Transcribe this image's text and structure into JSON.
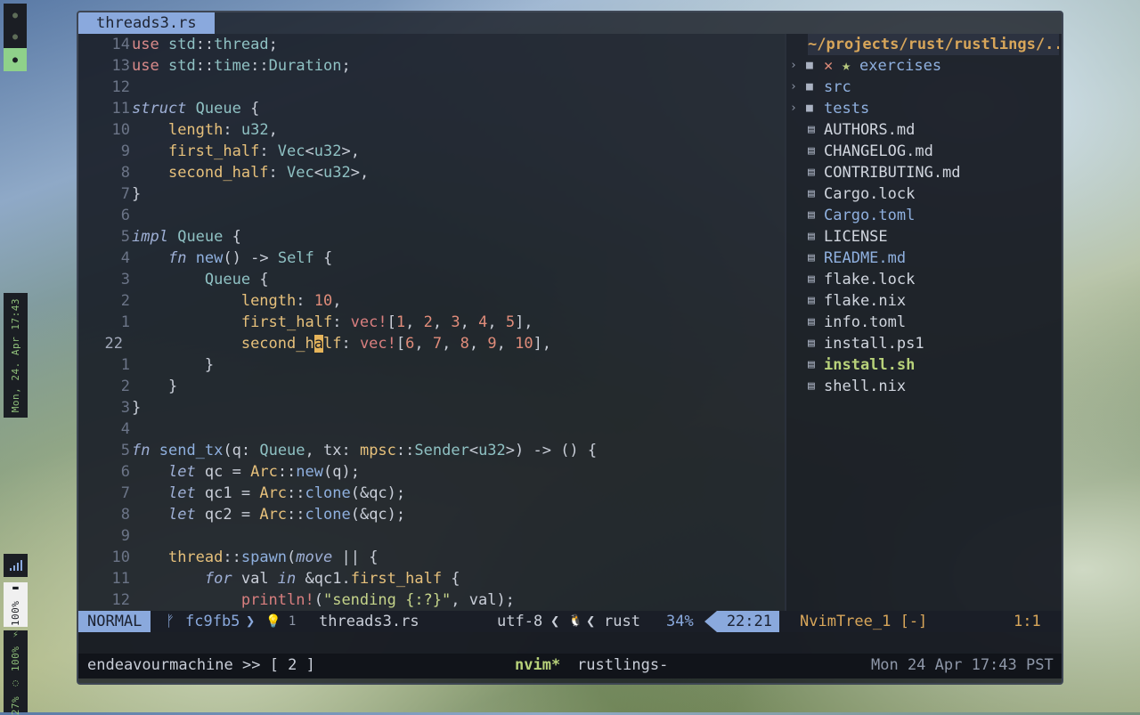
{
  "sidebar": {
    "workspaces": [
      "●",
      "●",
      "●"
    ],
    "clock": "Mon, 24. Apr  17:43",
    "volume": "100% ▬",
    "battery": "27% ◌ 100% ⚡"
  },
  "tab": {
    "title": "threads3.rs"
  },
  "editor": {
    "line_numbers": [
      "14",
      "13",
      "12",
      "11",
      "10",
      "9",
      "8",
      "7",
      "6",
      "5",
      "4",
      "3",
      "2",
      "1",
      "22",
      "1",
      "2",
      "3",
      "4",
      "5",
      "6",
      "7",
      "8",
      "9",
      "10",
      "11",
      "12"
    ],
    "current_line_index": 14
  },
  "tree": {
    "root": "~/projects/rust/rustlings/..",
    "items": [
      {
        "name": "exercises",
        "type": "dir",
        "marks": "✕",
        "star": "★"
      },
      {
        "name": "src",
        "type": "dir"
      },
      {
        "name": "tests",
        "type": "dir"
      },
      {
        "name": "AUTHORS.md",
        "type": "file"
      },
      {
        "name": "CHANGELOG.md",
        "type": "file"
      },
      {
        "name": "CONTRIBUTING.md",
        "type": "file"
      },
      {
        "name": "Cargo.lock",
        "type": "file"
      },
      {
        "name": "Cargo.toml",
        "type": "file",
        "style": "mod"
      },
      {
        "name": "LICENSE",
        "type": "file"
      },
      {
        "name": "README.md",
        "type": "file",
        "style": "mod"
      },
      {
        "name": "flake.lock",
        "type": "file"
      },
      {
        "name": "flake.nix",
        "type": "file"
      },
      {
        "name": "info.toml",
        "type": "file"
      },
      {
        "name": "install.ps1",
        "type": "file"
      },
      {
        "name": "install.sh",
        "type": "file",
        "style": "green"
      },
      {
        "name": "shell.nix",
        "type": "file"
      }
    ]
  },
  "status": {
    "mode": "NORMAL",
    "branch_icon": "ᚠ",
    "commit": "fc9fb5",
    "diagnostics": "💡 1",
    "file": "threads3.rs",
    "encoding": "utf-8",
    "os_icon": "🐧",
    "filetype": "rust",
    "percent": "34%",
    "position": "22:21",
    "tree_name": "NvimTree_1 [-]",
    "tree_pos": "1:1"
  },
  "tmux": {
    "session": "endeavourmachine >> [ 2 ]",
    "window_active": "nvim*",
    "window_other": "rustlings-",
    "datetime": "Mon 24 Apr 17:43 PST"
  },
  "colors": {
    "accent": "#8aa9dd",
    "tree_root": "#d8a65a",
    "green": "#b8d27a"
  }
}
